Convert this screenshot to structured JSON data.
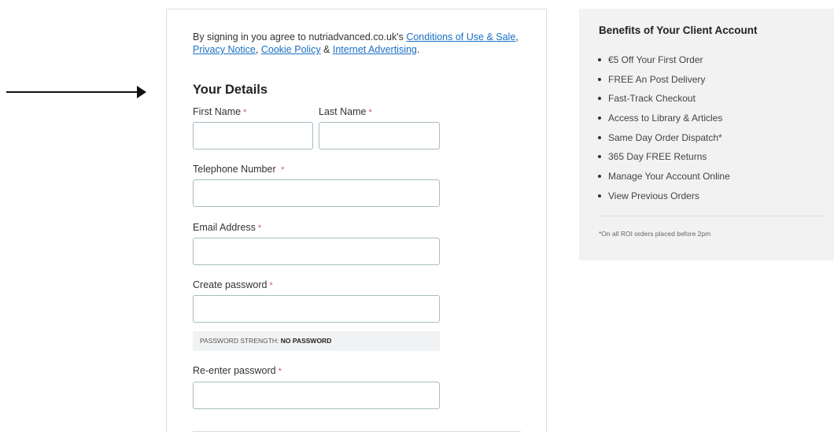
{
  "agreement": {
    "prefix": "By signing in you agree to nutriadvanced.co.uk's ",
    "conditions_link": "Conditions of Use & Sale",
    "sep1": ",",
    "privacy_link": "Privacy Notice",
    "sep2": ", ",
    "cookie_link": "Cookie Policy",
    "sep3": " & ",
    "advertising_link": "Internet Advertising",
    "suffix": "."
  },
  "form": {
    "section_title": "Your Details",
    "required_mark": "*",
    "first_name": {
      "label": "First Name",
      "value": ""
    },
    "last_name": {
      "label": "Last Name",
      "value": ""
    },
    "telephone": {
      "label": "Telephone Number ",
      "value": ""
    },
    "email": {
      "label": "Email Address",
      "value": ""
    },
    "create_password": {
      "label": "Create password",
      "value": ""
    },
    "password_strength": {
      "label": "PASSWORD STRENGTH: ",
      "value": "NO PASSWORD"
    },
    "reenter_password": {
      "label": "Re-enter password",
      "value": ""
    }
  },
  "benefits": {
    "title": "Benefits of Your Client Account",
    "items": [
      "€5 Off Your First Order",
      "FREE An Post Delivery",
      "Fast-Track Checkout",
      "Access to Library & Articles",
      "Same Day Order Dispatch*",
      "365 Day FREE Returns",
      "Manage Your Account Online",
      "View Previous Orders"
    ],
    "footnote": "*On all ROI orders placed before 2pm"
  },
  "colors": {
    "link": "#1a6fc4",
    "required": "#d9534f",
    "input_border": "#a9bcc2",
    "panel_bg": "#f2f2f2"
  }
}
